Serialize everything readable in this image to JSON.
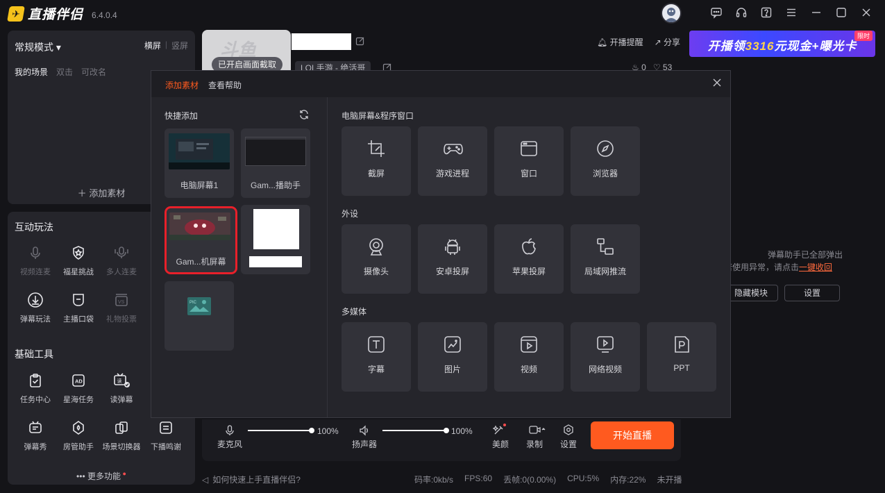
{
  "app": {
    "name": "直播伴侣",
    "version": "6.4.0.4",
    "brand_color": "#f5c21b",
    "accent_color": "#ff5a1f"
  },
  "titlebar": {
    "icons": [
      "message-icon",
      "headset-icon",
      "help-icon",
      "menu-icon",
      "minimize-icon",
      "maximize-icon",
      "close-icon"
    ]
  },
  "scene": {
    "mode": "常规模式",
    "orient_landscape": "横屏",
    "orient_portrait": "竖屏",
    "my_scene": "我的场景",
    "hint1": "双击",
    "hint2": "可改名",
    "add_material": "添加素材"
  },
  "interact": {
    "title": "互动玩法",
    "items": [
      {
        "label": "视频连麦",
        "enabled": false
      },
      {
        "label": "福星挑战",
        "enabled": true
      },
      {
        "label": "多人连麦",
        "enabled": false
      },
      {
        "label": "弹幕玩法",
        "enabled": true
      },
      {
        "label": "主播口袋",
        "enabled": true
      },
      {
        "label": "礼物投票",
        "enabled": false
      }
    ]
  },
  "basic_tools": {
    "title": "基础工具",
    "items": [
      {
        "label": "任务中心"
      },
      {
        "label": "星海任务"
      },
      {
        "label": "读弹幕"
      },
      {
        "label": "弹幕秀"
      },
      {
        "label": "房管助手"
      },
      {
        "label": "场景切换器"
      },
      {
        "label": "下播鸣谢"
      }
    ],
    "more": "更多功能"
  },
  "stream": {
    "thumb_badge": "已开启画面截取",
    "game_tag": "LOL手游 - 绝活哥",
    "remind": "开播提醒",
    "share": "分享",
    "hot": "0",
    "likes": "53",
    "banner_pre": "开播领",
    "banner_num": "3316",
    "banner_post": "元现金+曝光卡",
    "banner_tag": "限时"
  },
  "danmaku": {
    "line1": "弹幕助手已全部弹出",
    "line2_pre": "若使用异常，请点击",
    "line2_link": "一键收回",
    "hide_btn": "隐藏模块",
    "settings_btn": "设置"
  },
  "controls": {
    "mic": "麦克风",
    "mic_volume": "100%",
    "mic_level": 1.0,
    "speaker": "扬声器",
    "speaker_volume": "100%",
    "speaker_level": 1.0,
    "beauty": "美颜",
    "record": "录制",
    "settings": "设置",
    "start": "开始直播"
  },
  "status": {
    "help": "如何快速上手直播伴侣?",
    "bitrate": "码率:0kb/s",
    "fps": "FPS:60",
    "drop": "丢帧:0(0.00%)",
    "cpu": "CPU:5%",
    "mem": "内存:22%",
    "live": "未开播"
  },
  "modal": {
    "tab_add": "添加素材",
    "tab_help": "查看帮助",
    "quick_title": "快捷添加",
    "quick_items": [
      {
        "label": "电脑屏幕1"
      },
      {
        "label": "Gam...播助手"
      },
      {
        "label": "Gam...机屏幕",
        "selected": true
      },
      {
        "label": ""
      },
      {
        "label": ""
      }
    ],
    "groups": [
      {
        "title": "电脑屏幕&程序窗口",
        "items": [
          {
            "label": "截屏",
            "icon": "crop-icon"
          },
          {
            "label": "游戏进程",
            "icon": "gamepad-icon"
          },
          {
            "label": "窗口",
            "icon": "window-icon"
          },
          {
            "label": "浏览器",
            "icon": "compass-icon"
          }
        ]
      },
      {
        "title": "外设",
        "items": [
          {
            "label": "摄像头",
            "icon": "camera-icon"
          },
          {
            "label": "安卓投屏",
            "icon": "android-icon"
          },
          {
            "label": "苹果投屏",
            "icon": "apple-icon"
          },
          {
            "label": "局域网推流",
            "icon": "lan-icon"
          }
        ]
      },
      {
        "title": "多媒体",
        "items": [
          {
            "label": "字幕",
            "icon": "text-icon"
          },
          {
            "label": "图片",
            "icon": "image-icon"
          },
          {
            "label": "视频",
            "icon": "video-icon"
          },
          {
            "label": "网络视频",
            "icon": "web-video-icon"
          },
          {
            "label": "PPT",
            "icon": "ppt-icon"
          }
        ]
      }
    ]
  }
}
